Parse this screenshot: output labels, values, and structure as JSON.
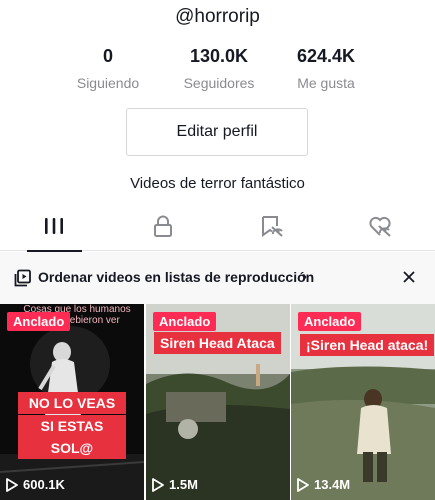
{
  "profile": {
    "username": "@horrorip",
    "bio": "Videos de terror fantástico",
    "edit_button": "Editar perfil"
  },
  "stats": [
    {
      "value": "0",
      "label": "Siguiendo"
    },
    {
      "value": "130.0K",
      "label": "Seguidores"
    },
    {
      "value": "624.4K",
      "label": "Me gusta"
    }
  ],
  "tabs": [
    {
      "icon": "grid-icon",
      "selected": true
    },
    {
      "icon": "lock-icon",
      "selected": false
    },
    {
      "icon": "saved-icon",
      "selected": false
    },
    {
      "icon": "liked-icon",
      "selected": false
    }
  ],
  "playlist_bar": {
    "text": "Ordenar videos en listas de reproducción",
    "chevron": "›",
    "close": "×"
  },
  "videos": [
    {
      "pinned_label": "Anclado",
      "caption_top": "Cosas que los humanos nunca debieron ver",
      "overlay_lines": [
        "NO LO VEAS",
        "SI ESTAS SOL@"
      ],
      "views": "600.1K"
    },
    {
      "pinned_label": "Anclado",
      "title": "Siren Head Ataca",
      "views": "1.5M"
    },
    {
      "pinned_label": "Anclado",
      "title": "¡Siren Head ataca!",
      "views": "13.4M"
    }
  ],
  "colors": {
    "accent": "#fe2c55",
    "overlay_red": "#e8313f",
    "text": "#161823",
    "muted": "#8a8b91"
  }
}
